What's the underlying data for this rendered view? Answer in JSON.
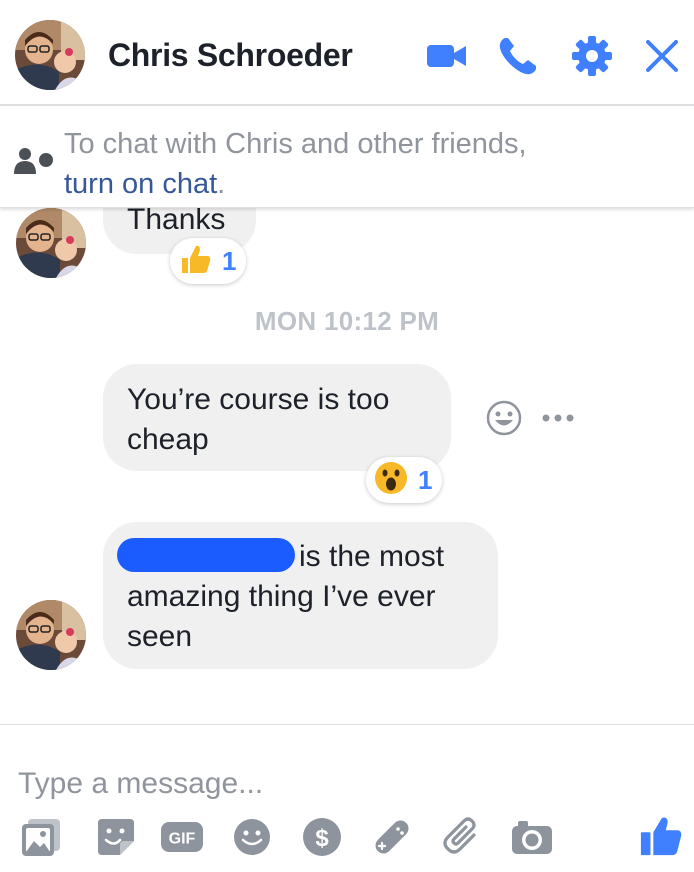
{
  "header": {
    "title": "Chris Schroeder",
    "icons": [
      "video-camera-icon",
      "phone-icon",
      "gear-icon",
      "close-icon"
    ],
    "accent_color": "#4080ff"
  },
  "notice": {
    "text_before": "To chat with Chris and other friends,",
    "link_text": "turn on chat",
    "text_after": "."
  },
  "messages": [
    {
      "text": "Thanks",
      "reaction": {
        "icon": "thumbs-up-icon",
        "count": "1"
      }
    },
    {
      "text": "You’re course is too cheap",
      "reaction": {
        "icon": "wow-face-icon",
        "count": "1"
      }
    },
    {
      "text_after_redaction": "is the most amazing thing I’ve ever seen"
    }
  ],
  "timestamp": "MON 10:12 PM",
  "composer": {
    "placeholder": "Type a message...",
    "gif_label": "GIF",
    "tools": [
      "photo-icon",
      "sticker-icon",
      "gif-icon",
      "emoji-icon",
      "payment-icon",
      "game-icon",
      "attachment-icon",
      "camera-icon",
      "like-icon"
    ]
  },
  "colors": {
    "bubble_background": "#f1f0f0",
    "link": "#365899",
    "muted_text": "#90949c"
  }
}
